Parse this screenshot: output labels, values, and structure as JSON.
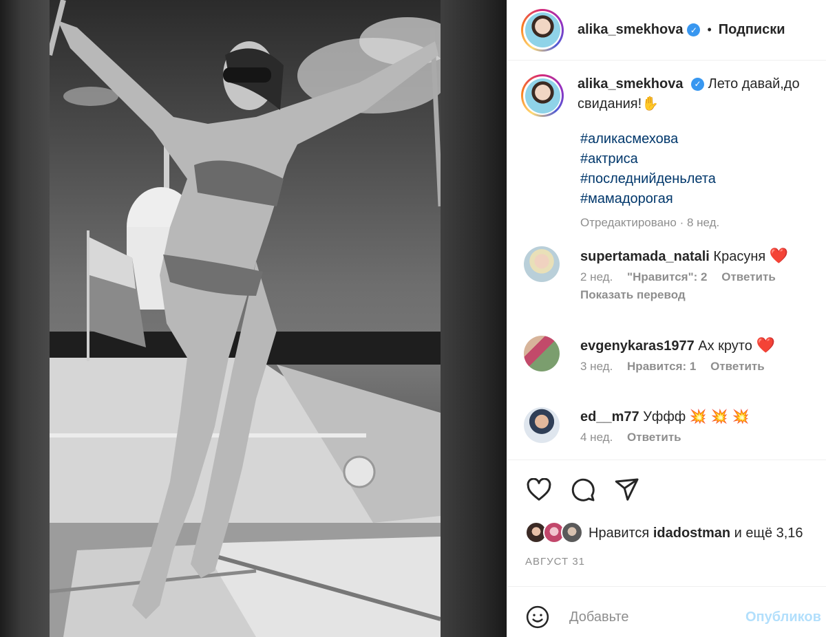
{
  "post": {
    "author": "alika_smekhova",
    "follow_label": "Подписки",
    "separator": "•",
    "verified_mark": "✓",
    "caption_text": "Лето давай,до свидания!✋",
    "hashtags": [
      "#аликасмехова",
      "#актриса",
      "#последнийденьлета",
      "#мамадорогая"
    ],
    "edited_meta": "Отредактировано · 8 нед."
  },
  "comments": [
    {
      "username": "supertamada_natali",
      "text": "Красуня",
      "emoji": "❤️",
      "time": "2 нед.",
      "likes": "\"Нравится\": 2",
      "reply": "Ответить",
      "translate": "Показать перевод"
    },
    {
      "username": "evgenykaras1977",
      "text": "Ах круто",
      "emoji": "❤️",
      "time": "3 нед.",
      "likes": "Нравится: 1",
      "reply": "Ответить"
    },
    {
      "username": "ed__m77",
      "text": "Уффф",
      "emoji": "💥💥💥",
      "time": "4 нед.",
      "reply": "Ответить"
    }
  ],
  "likes": {
    "prefix": "Нравится",
    "user": "idadostman",
    "suffix": "и ещё 3,16"
  },
  "date": "АВГУСТ 31",
  "comment_box": {
    "placeholder": "Добавьте",
    "publish_label": "Опубликов"
  },
  "icons": [
    "heart-icon",
    "comment-icon",
    "share-icon",
    "emoji-icon"
  ],
  "colors": {
    "link": "#00376b",
    "muted": "#8e8e8e",
    "verified": "#3897f0",
    "heart": "#e0202f",
    "publish_disabled": "#b2dffc"
  }
}
